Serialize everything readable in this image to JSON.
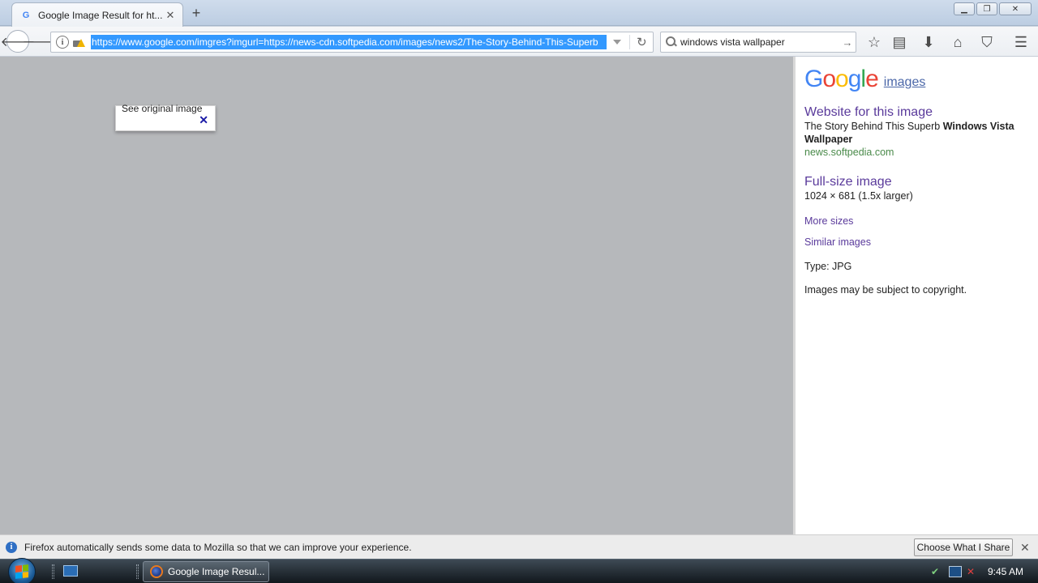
{
  "browser": {
    "tab": {
      "title": "Google Image Result for ht...",
      "favicon_letter": "G"
    },
    "url": "https://www.google.com/imgres?imgurl=https://news-cdn.softpedia.com/images/news2/The-Story-Behind-This-Superb",
    "search": {
      "value": "windows vista wallpaper"
    }
  },
  "preview": {
    "see_original": "See original image"
  },
  "panel": {
    "logo_letters": [
      {
        "char": "G",
        "color": "#4285f4"
      },
      {
        "char": "o",
        "color": "#ea4335"
      },
      {
        "char": "o",
        "color": "#fbbc05"
      },
      {
        "char": "g",
        "color": "#4285f4"
      },
      {
        "char": "l",
        "color": "#34a853"
      },
      {
        "char": "e",
        "color": "#ea4335"
      }
    ],
    "images_link": "images",
    "website_heading": "Website for this image",
    "site_title_plain": "The Story Behind This Superb ",
    "site_title_bold": "Windows Vista Wallpaper",
    "site_domain": "news.softpedia.com",
    "fullsize_heading": "Full-size image",
    "dimensions": "1024 × 681 (1.5x larger)",
    "more_sizes": "More sizes",
    "similar_images": "Similar images",
    "type": "Type:  JPG",
    "copyright": "Images may be subject to copyright."
  },
  "notification": {
    "text": "Firefox automatically sends some data to Mozilla so that we can improve your experience.",
    "button": "Choose What I Share"
  },
  "taskbar": {
    "task_label": "Google Image Resul...",
    "clock": "9:45 AM"
  }
}
